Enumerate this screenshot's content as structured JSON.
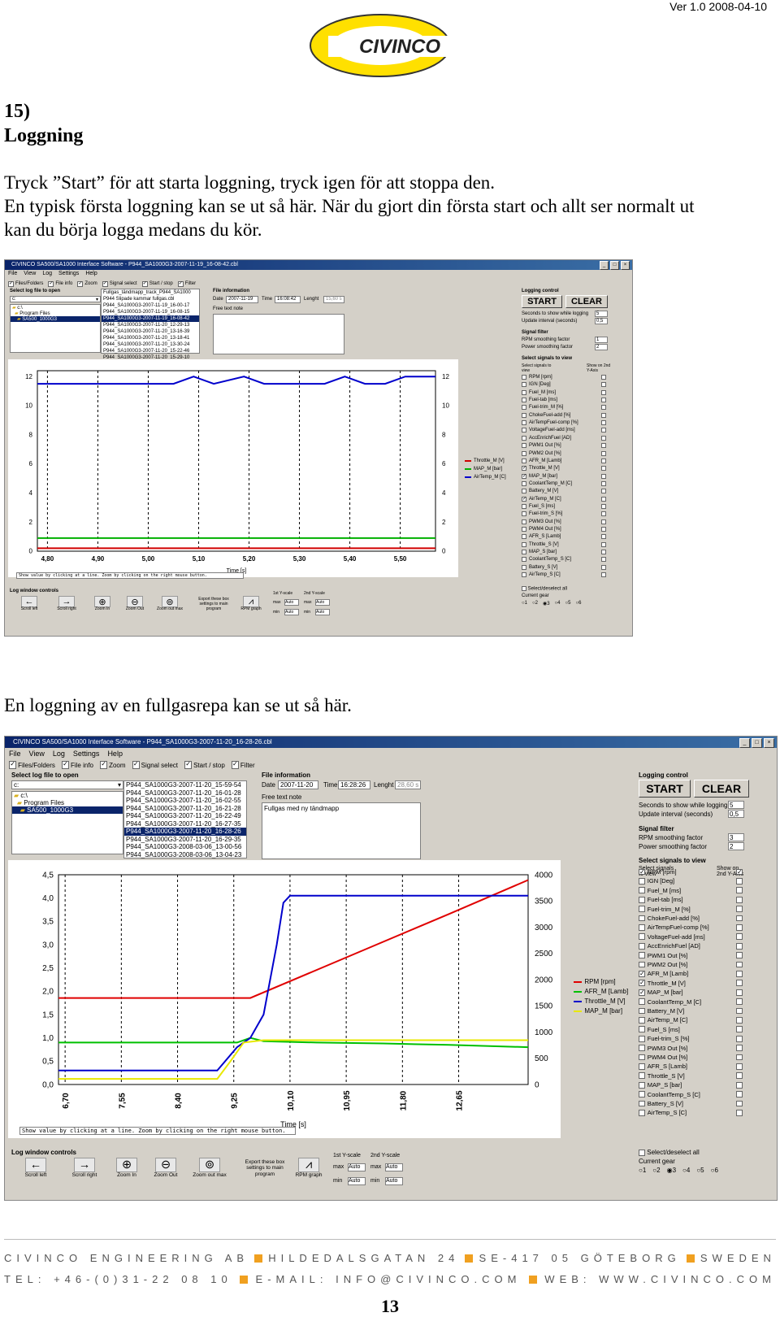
{
  "header": {
    "version": "Ver 1.0 2008-04-10",
    "logo_text": "CIVINCO"
  },
  "section": {
    "number": "15)",
    "title": "Loggning"
  },
  "paragraphs": [
    "Tryck ”Start” för att starta loggning, tryck igen för att stoppa den.",
    "En typisk första loggning kan se ut så här. När du gjort din första start och allt ser normalt ut",
    "kan du börja logga medans du kör."
  ],
  "caption2": "En loggning av en fullgasrepa kan se ut så här.",
  "app1": {
    "title": "CIVINCO SA500/SA1000 Interface Software - P944_SA1000G3-2007-11-19_16-08-42.cbl",
    "menu": [
      "File",
      "View",
      "Log",
      "Settings",
      "Help"
    ],
    "toolbar": [
      "Files/Folders",
      "File info",
      "Zoom",
      "Signal select",
      "Start / stop",
      "Filter"
    ],
    "select_log_title": "Select log file to open",
    "drive": "c:",
    "folders": [
      "c:\\",
      "Program Files",
      "SA500_1000G3"
    ],
    "files": [
      "Fullgas_tändmapp_track_P944_SA1000",
      "P944 Slipade kammar fullgas.cbl",
      "P944_SA1000G3-2007-11-19_16-00-17",
      "P944_SA1000G3-2007-11-19_16-08-15",
      "P944_SA1000G3-2007-11-19_16-08-42",
      "P944_SA1000G3-2007-11-20_12-29-13",
      "P944_SA1000G3-2007-11-20_13-16-39",
      "P944_SA1000G3-2007-11-20_13-18-41",
      "P944_SA1000G3-2007-11-20_13-30-24",
      "P944_SA1000G3-2007-11-20_15-22-46",
      "P944_SA1000G3-2007-11-20_15-29-10"
    ],
    "selected_file_index": 4,
    "file_info": {
      "title": "File information",
      "date_label": "Date",
      "date": "2007-11-19",
      "time_label": "Time",
      "time": "16:08:42",
      "length_label": "Lenght",
      "length": "15,60 s",
      "note_label": "Free text note",
      "note": ""
    },
    "logging": {
      "title": "Logging control",
      "start": "START",
      "clear": "CLEAR",
      "seconds_label": "Seconds to show while logging",
      "seconds": "5",
      "update_label": "Update interval (seconds)",
      "update": "0,5"
    },
    "filter": {
      "title": "Signal filter",
      "rpm_label": "RPM smoothing factor",
      "rpm": "1",
      "power_label": "Power smoothing factor",
      "power": "2"
    },
    "signals_title": "Select signals to view",
    "select_signals_label": "Select signals to view",
    "show_on_label": "Show on 2nd Y-Axis",
    "signals": [
      "RPM [rpm]",
      "IGN [Deg]",
      "Fuel_M [ms]",
      "Fuel-tab [ms]",
      "Fuel-trim_M [%]",
      "ChokeFuel-add [%]",
      "AirTempFuel-comp [%]",
      "VoltageFuel-add [ms]",
      "AccEnrichFuel [AD]",
      "PWM1 Out [%]",
      "PWM2 Out [%]",
      "AFR_M [Lamb]",
      "Throttle_M [V]",
      "MAP_M [bar]",
      "CoolantTemp_M [C]",
      "Battery_M [V]",
      "AirTemp_M [C]",
      "Fuel_S [ms]",
      "Fuel-trim_S [%]",
      "PWM3 Out [%]",
      "PWM4 Out [%]",
      "AFR_S [Lamb]",
      "Throttle_S [V]",
      "MAP_S [bar]",
      "CoolantTemp_S [C]",
      "Battery_S [V]",
      "AirTemp_S [C]"
    ],
    "signals_checked": [
      12,
      13,
      16
    ],
    "select_all": "Select/deselect all",
    "current_gear": "Current gear",
    "gears": [
      "1",
      "2",
      "3",
      "4",
      "5",
      "6"
    ],
    "gear_selected": 2,
    "status": "Show value by clicking at a line. Zoom by clicking on the right mouse button.",
    "log_controls": "Log window controls",
    "controls": [
      "Scroll left",
      "Scroll right",
      "Zoom In",
      "Zoom Out",
      "Zoom out max",
      "Export these box settings to main program",
      "RPM graph"
    ],
    "scale": {
      "y1_label": "1st Y-scale",
      "y2_label": "2nd Y-scale",
      "max_label": "max",
      "min_label": "min",
      "auto": "Auto"
    },
    "legend": [
      "Throttle_M [V]",
      "MAP_M [bar]",
      "AirTemp_M [C]"
    ],
    "legend_colors": [
      "#d00000",
      "#00b000",
      "#0000cc"
    ]
  },
  "app2": {
    "title": "CIVINCO SA500/SA1000 Interface Software - P944_SA1000G3-2007-11-20_16-28-26.cbl",
    "files": [
      "P944_SA1000G3-2007-11-20_15-59-54",
      "P944_SA1000G3-2007-11-20_16-01-28",
      "P944_SA1000G3-2007-11-20_16-02-55",
      "P944_SA1000G3-2007-11-20_16-21-28",
      "P944_SA1000G3-2007-11-20_16-22-49",
      "P944_SA1000G3-2007-11-20_16-27-35",
      "P944_SA1000G3-2007-11-20_16-28-26",
      "P944_SA1000G3-2007-11-20_16-29-35",
      "P944_SA1000G3-2008-03-06_13-00-56",
      "P944_SA1000G3-2008-03-06_13-04-23"
    ],
    "selected_file_index": 6,
    "folders": [
      "c:\\",
      "Program Files",
      "SA500_1000G3"
    ],
    "file_info": {
      "date": "2007-11-20",
      "time": "16:28:26",
      "length": "28,60 s",
      "note": "Fullgas med ny tändmapp"
    },
    "filter": {
      "rpm": "3",
      "power": "2"
    },
    "signals_checked": [
      0,
      11,
      12,
      13
    ],
    "second_axis_checked": [
      0
    ],
    "legend": [
      "RPM [rpm]",
      "AFR_M [Lamb]",
      "Throttle_M [V]",
      "MAP_M [bar]"
    ],
    "legend_colors": [
      "#e00000",
      "#00c000",
      "#0000cc",
      "#e8e800"
    ]
  },
  "chart_data": [
    {
      "type": "line",
      "x_ticks": [
        "4,80",
        "4,90",
        "5,00",
        "5,10",
        "5,20",
        "5,30",
        "5,40",
        "5,50"
      ],
      "xlim": [
        4.78,
        5.57
      ],
      "y_ticks": [
        "0",
        "2",
        "4",
        "6",
        "8",
        "10",
        "12"
      ],
      "ylim": [
        0,
        12.4
      ],
      "y2_ticks": [
        "0",
        "2",
        "4",
        "6",
        "8",
        "10",
        "12"
      ],
      "xlabel": "Time [s]",
      "grid": "vertical dashed",
      "series": [
        {
          "name": "Throttle_M [V]",
          "color": "#d00000",
          "x": [
            4.78,
            5.57
          ],
          "y": [
            0.2,
            0.2
          ]
        },
        {
          "name": "MAP_M [bar]",
          "color": "#00b000",
          "x": [
            4.78,
            5.57
          ],
          "y": [
            0.9,
            0.9
          ]
        },
        {
          "name": "AirTemp_M [C]",
          "color": "#0000cc",
          "x": [
            4.78,
            5.05,
            5.09,
            5.13,
            5.19,
            5.23,
            5.35,
            5.39,
            5.43,
            5.47,
            5.51,
            5.57
          ],
          "y": [
            11.5,
            11.5,
            12.0,
            11.5,
            12.0,
            11.5,
            11.5,
            12.0,
            11.5,
            11.5,
            12.0,
            12.0
          ]
        }
      ]
    },
    {
      "type": "line",
      "x_ticks": [
        "6,70",
        "7,55",
        "8,40",
        "9,25",
        "10,10",
        "10,95",
        "11,80",
        "12,65"
      ],
      "xlim": [
        6.6,
        13.7
      ],
      "y_ticks": [
        "0,0",
        "0,5",
        "1,0",
        "1,5",
        "2,0",
        "2,5",
        "3,0",
        "3,5",
        "4,0",
        "4,5"
      ],
      "ylim": [
        0,
        4.5
      ],
      "y2_ticks": [
        "0",
        "500",
        "1000",
        "1500",
        "2000",
        "2500",
        "3000",
        "3500",
        "4000"
      ],
      "y2lim": [
        0,
        4000
      ],
      "xlabel": "Time [s]",
      "grid": "vertical dashed",
      "series": [
        {
          "name": "RPM [rpm]",
          "color": "#e00000",
          "axis": "y2",
          "x": [
            6.6,
            9.5,
            11.0,
            12.5,
            13.7
          ],
          "y": [
            1650,
            1650,
            2450,
            3250,
            3900
          ]
        },
        {
          "name": "AFR_M [Lamb]",
          "color": "#00c000",
          "x": [
            6.6,
            9.3,
            9.5,
            9.7,
            10.5,
            11.5,
            12.5,
            13.7
          ],
          "y": [
            0.9,
            0.9,
            1.0,
            0.93,
            0.9,
            0.88,
            0.85,
            0.8
          ]
        },
        {
          "name": "Throttle_M [V]",
          "color": "#0000cc",
          "x": [
            6.6,
            9.0,
            9.3,
            9.5,
            9.7,
            9.9,
            10.0,
            10.1,
            13.7
          ],
          "y": [
            0.3,
            0.3,
            0.8,
            1.0,
            1.5,
            3.0,
            3.9,
            4.05,
            4.05
          ]
        },
        {
          "name": "MAP_M [bar]",
          "color": "#e8e800",
          "x": [
            6.6,
            9.0,
            9.2,
            9.4,
            9.7,
            13.7
          ],
          "y": [
            0.12,
            0.12,
            0.5,
            0.9,
            0.95,
            0.95
          ]
        }
      ]
    }
  ],
  "footer": {
    "line1": [
      "CIVINCO ENGINEERING AB",
      "HILDEDALSGATAN 24",
      "SE-417 05 GÖTEBORG",
      "SWEDEN"
    ],
    "line2": [
      "TEL: +46-(0)31-22 08 10",
      "E-MAIL: INFO@CIVINCO.COM",
      "WEB: WWW.CIVINCO.COM"
    ],
    "page": "13"
  }
}
